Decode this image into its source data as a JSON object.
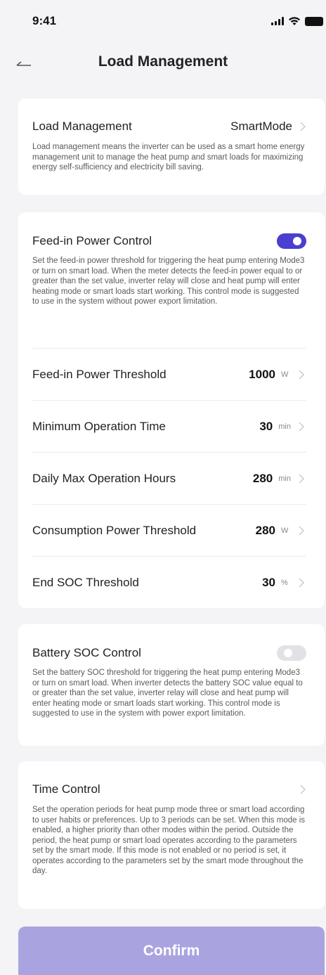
{
  "status_bar": {
    "time": "9:41"
  },
  "nav": {
    "title": "Load Management"
  },
  "load_management": {
    "label": "Load Management",
    "value": "SmartMode",
    "description": "Load management means the inverter can be used as a smart home energy management unit to manage the heat pump and smart loads for maximizing energy self-sufficiency and electricity bill saving."
  },
  "feed_in": {
    "title": "Feed-in Power Control",
    "enabled": true,
    "description": "Set the feed-in power threshold for triggering the heat pump entering Mode3 or turn on smart load. When the meter detects the feed-in power equal to or greater than the set value, inverter relay will close and heat pump will enter heating mode or smart loads start working. This control mode is suggested to use in the system without power export limitation.",
    "params": [
      {
        "label": "Feed-in Power Threshold",
        "value": "1000",
        "unit": "W"
      },
      {
        "label": "Minimum Operation Time",
        "value": "30",
        "unit": "min"
      },
      {
        "label": "Daily Max Operation Hours",
        "value": "280",
        "unit": "min"
      },
      {
        "label": "Consumption Power Threshold",
        "value": "280",
        "unit": "W"
      },
      {
        "label": "End SOC Threshold",
        "value": "30",
        "unit": "%"
      }
    ]
  },
  "battery_soc": {
    "title": "Battery SOC Control",
    "enabled": false,
    "description": "Set the battery SOC threshold for triggering the heat pump entering Mode3 or turn on smart load. When inverter detects the battery SOC value equal to or greater than the set value, inverter relay will close and heat pump will enter heating mode or smart loads start working. This control mode is suggested to use in the system with power export limitation."
  },
  "time_control": {
    "title": "Time Control",
    "description": "Set the operation periods for heat pump mode three or smart load according to user habits or preferences. Up to 3 periods can be set. When this mode is enabled, a higher priority than other modes within the period. Outside the period, the heat pump or smart load operates according to the parameters set by the smart mode. If this mode is not enabled or no period is set, it operates according to the parameters set by the smart mode throughout the day."
  },
  "confirm_label": "Confirm",
  "colors": {
    "accent": "#4a3fcf",
    "confirm_bg": "#a9a4e0",
    "background": "#f4f4f6"
  }
}
